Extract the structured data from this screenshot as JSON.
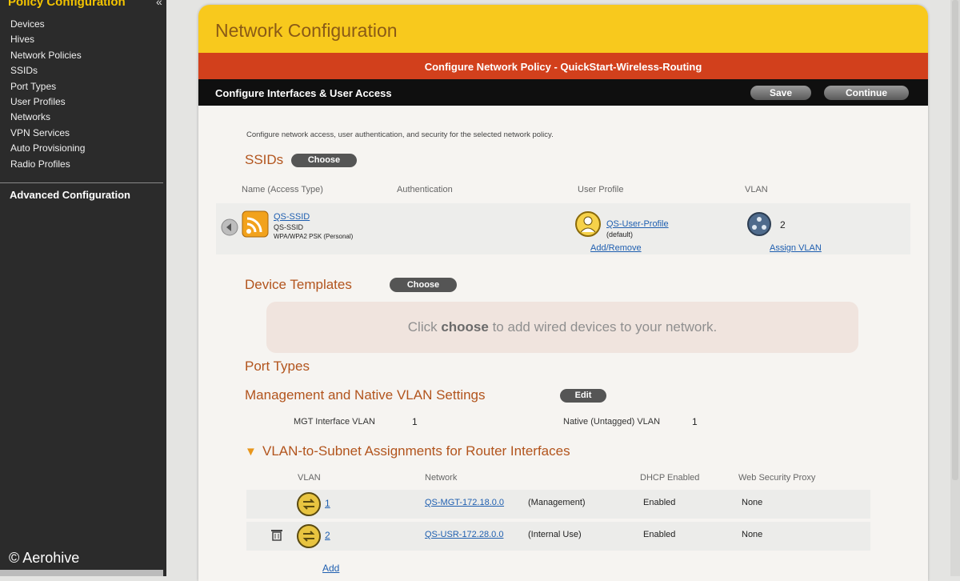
{
  "sidebar": {
    "title": "Policy Configuration",
    "collapse_glyph": "«",
    "items": [
      "Devices",
      "Hives",
      "Network Policies",
      "SSIDs",
      "Port Types",
      "User Profiles",
      "Networks",
      "VPN Services",
      "Auto Provisioning",
      "Radio Profiles"
    ],
    "advanced": "Advanced Configuration"
  },
  "copyright": "© Aerohive",
  "panel": {
    "title": "Network Configuration",
    "subtitle": "Configure Network Policy - QuickStart-Wireless-Routing",
    "bar_title": "Configure Interfaces & User Access",
    "save_label": "Save",
    "continue_label": "Continue",
    "description": "Configure network access, user authentication, and security for the selected network policy."
  },
  "ssids": {
    "heading": "SSIDs",
    "choose_label": "Choose",
    "columns": {
      "name": "Name (Access Type)",
      "auth": "Authentication",
      "profile": "User Profile",
      "vlan": "VLAN"
    },
    "row": {
      "name": "QS-SSID",
      "line2": "QS-SSID",
      "line3": "WPA/WPA2 PSK (Personal)",
      "profile": "QS-User-Profile",
      "profile_sub": "(default)",
      "vlan": "2",
      "add_remove": "Add/Remove",
      "assign_vlan": "Assign VLAN"
    }
  },
  "device_templates": {
    "heading": "Device Templates",
    "choose_label": "Choose",
    "placeholder_pre": "Click ",
    "placeholder_bold": "choose",
    "placeholder_post": " to add wired devices to your network."
  },
  "port_types": {
    "heading": "Port Types"
  },
  "mgmt": {
    "heading": "Management and Native VLAN Settings",
    "edit_label": "Edit",
    "mgt_label": "MGT Interface VLAN",
    "mgt_value": "1",
    "native_label": "Native (Untagged) VLAN",
    "native_value": "1"
  },
  "vlan_subnet": {
    "toggle": "▼",
    "heading": "VLAN-to-Subnet Assignments for Router Interfaces",
    "columns": {
      "vlan": "VLAN",
      "network": "Network",
      "dhcp": "DHCP Enabled",
      "proxy": "Web Security Proxy"
    },
    "rows": [
      {
        "vlan": "1",
        "network": "QS-MGT-172.18.0.0",
        "note": "(Management)",
        "dhcp": "Enabled",
        "proxy": "None"
      },
      {
        "vlan": "2",
        "network": "QS-USR-172.28.0.0",
        "note": "(Internal Use)",
        "dhcp": "Enabled",
        "proxy": "None"
      }
    ],
    "add_label": "Add"
  },
  "colors": {
    "accent_yellow": "#f8c91d",
    "header_red": "#d2401c",
    "sidebar_bg": "#2b2b2b",
    "section_orange": "#b2541d",
    "link_blue": "#1f5fb0"
  },
  "icons": [
    "chevron-left-icon",
    "wifi-icon",
    "user-profile-icon",
    "vlan-network-icon",
    "router-icon",
    "delete-icon",
    "expand-arrow-icon"
  ]
}
